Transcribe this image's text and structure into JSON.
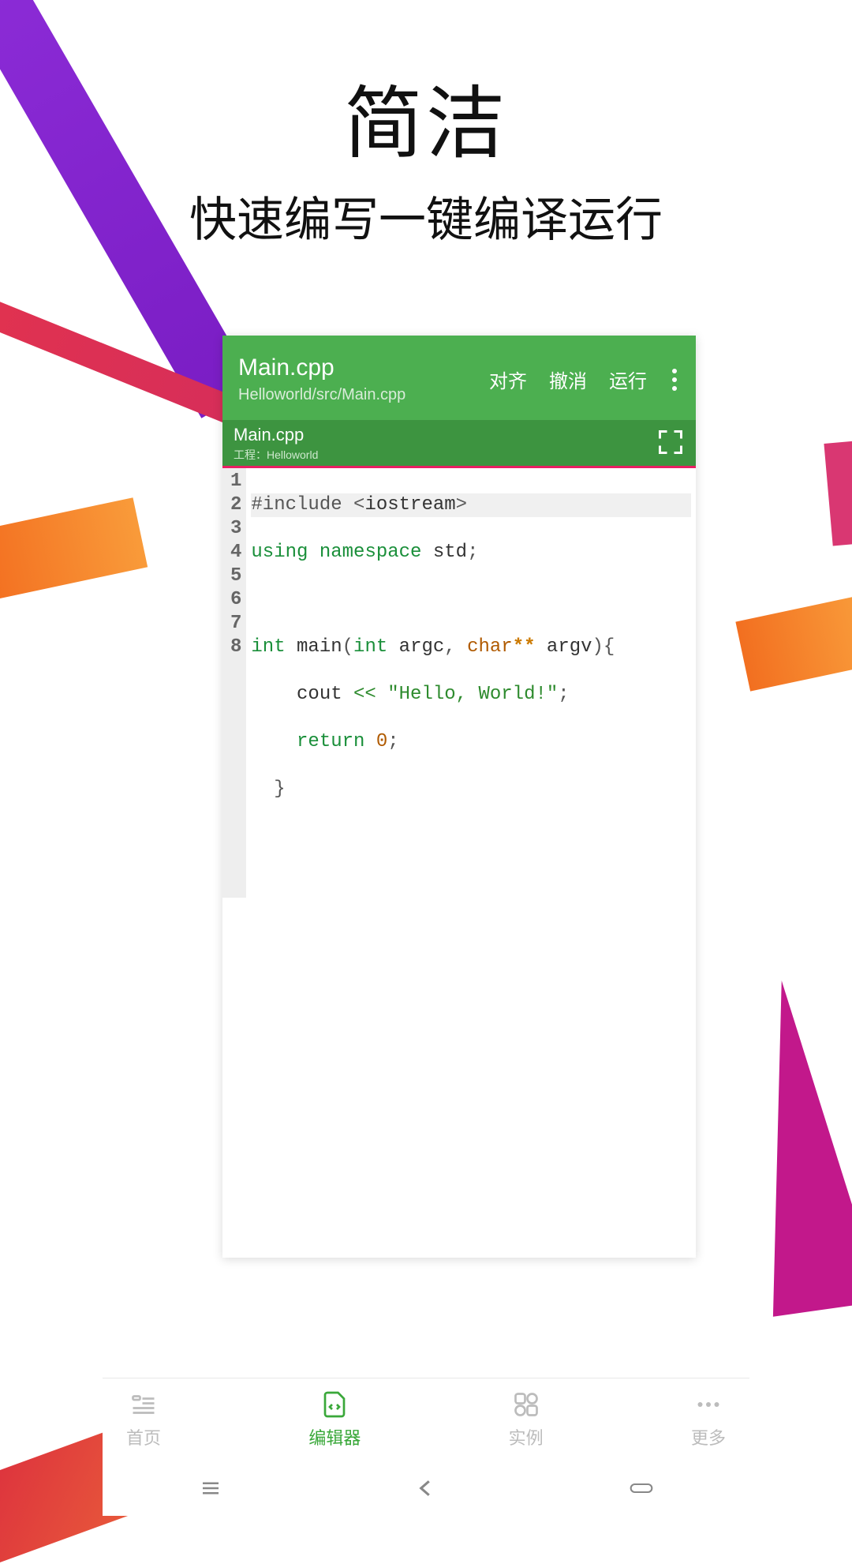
{
  "hero": {
    "title": "简洁",
    "subtitle": "快速编写一键编译运行"
  },
  "editor": {
    "header": {
      "filename": "Main.cpp",
      "path": "Helloworld/src/Main.cpp",
      "actions": {
        "align": "对齐",
        "undo": "撤消",
        "run": "运行"
      }
    },
    "tab": {
      "filename": "Main.cpp",
      "project_prefix": "工程：",
      "project_name": "Helloworld"
    },
    "code": {
      "lines": [
        {
          "n": "1",
          "raw": "#include <iostream>"
        },
        {
          "n": "2",
          "raw": "using namespace std;"
        },
        {
          "n": "3",
          "raw": ""
        },
        {
          "n": "4",
          "raw": "int main(int argc, char** argv){"
        },
        {
          "n": "5",
          "raw": "    cout << \"Hello, World!\";"
        },
        {
          "n": "6",
          "raw": "    return 0;"
        },
        {
          "n": "7",
          "raw": "  }"
        },
        {
          "n": "8",
          "raw": ""
        }
      ]
    }
  },
  "bottom_nav": {
    "home": "首页",
    "editor": "编辑器",
    "examples": "实例",
    "more": "更多"
  }
}
